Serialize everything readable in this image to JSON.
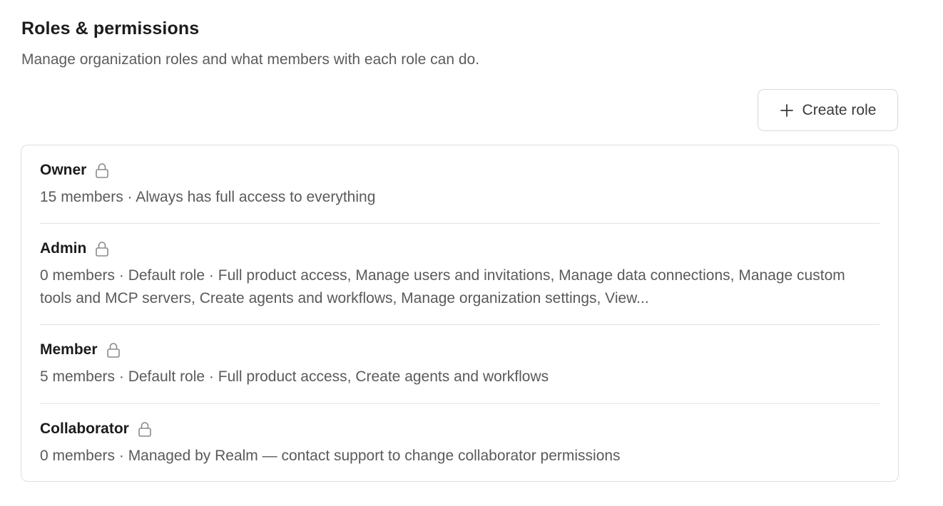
{
  "header": {
    "title": "Roles & permissions",
    "subtitle": "Manage organization roles and what members with each role can do."
  },
  "toolbar": {
    "create_icon": "plus-icon",
    "create_label": "Create role"
  },
  "roles": [
    {
      "name": "Owner",
      "icon": "lock-icon",
      "description": "15 members · Always has full access to everything"
    },
    {
      "name": "Admin",
      "icon": "lock-icon",
      "description": "0 members · Default role · Full product access, Manage users and invitations, Manage data connections, Manage custom tools and MCP servers, Create agents and workflows, Manage organization settings, View..."
    },
    {
      "name": "Member",
      "icon": "lock-icon",
      "description": "5 members · Default role · Full product access, Create agents and workflows"
    },
    {
      "name": "Collaborator",
      "icon": "lock-icon",
      "description": "0 members · Managed by Realm — contact support to change collaborator permissions"
    }
  ]
}
